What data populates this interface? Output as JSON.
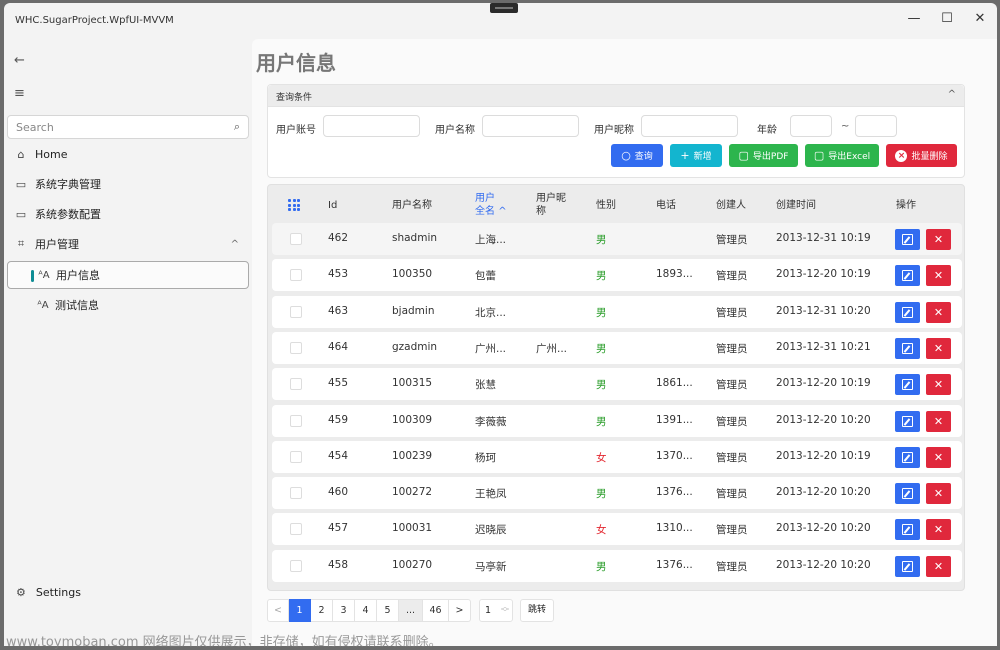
{
  "window": {
    "title": "WHC.SugarProject.WpfUI-MVVM",
    "controls": {
      "minimize": "—",
      "maximize": "☐",
      "close": "✕"
    }
  },
  "sidebar": {
    "back_icon": "←",
    "menu_icon": "≡",
    "search": {
      "placeholder": "Search",
      "value": "",
      "icon": "⌕"
    },
    "items": [
      {
        "label": "Home",
        "icon": "⌂"
      },
      {
        "label": "系统字典管理",
        "icon": "▭"
      },
      {
        "label": "系统参数配置",
        "icon": "▭"
      },
      {
        "label": "用户管理",
        "icon": "⌗",
        "expanded": true,
        "chevron": "^"
      },
      {
        "label": "用户信息",
        "icon": "ᴬA",
        "active": true
      },
      {
        "label": "测试信息",
        "icon": "ᴬA"
      }
    ],
    "settings": {
      "label": "Settings",
      "icon": "⚙"
    }
  },
  "page": {
    "title": "用户信息"
  },
  "query": {
    "header": "查询条件",
    "collapse_icon": "^",
    "fields": {
      "account": {
        "label": "用户账号",
        "value": ""
      },
      "name": {
        "label": "用户名称",
        "value": ""
      },
      "nickname": {
        "label": "用户昵称",
        "value": ""
      },
      "age": {
        "label": "年龄",
        "from": "",
        "to": "",
        "separator": "~"
      }
    },
    "buttons": {
      "search": {
        "label": "查询",
        "icon": "○"
      },
      "add": {
        "label": "新增",
        "icon": "+"
      },
      "export_pdf": {
        "label": "导出PDF",
        "icon": "▢"
      },
      "export_excel": {
        "label": "导出Excel",
        "icon": "▢"
      },
      "batch_delete": {
        "label": "批量删除",
        "icon": "×"
      }
    }
  },
  "table": {
    "columns": {
      "id": "Id",
      "username": "用户名称",
      "fullname_1": "用户",
      "fullname_2": "全名",
      "sort_icon": "^",
      "nickname_1": "用户昵",
      "nickname_2": "称",
      "gender": "性别",
      "phone": "电话",
      "creator": "创建人",
      "created": "创建时间",
      "actions": "操作"
    },
    "rows": [
      {
        "id": "462",
        "username": "shadmin",
        "fullname": "上海...",
        "nickname": "",
        "gender": "男",
        "phone": "",
        "creator": "管理员",
        "created": "2013-12-31 10:19"
      },
      {
        "id": "453",
        "username": "100350",
        "fullname": "包蕾",
        "nickname": "",
        "gender": "男",
        "phone": "1893...",
        "creator": "管理员",
        "created": "2013-12-20 10:19"
      },
      {
        "id": "463",
        "username": "bjadmin",
        "fullname": "北京...",
        "nickname": "",
        "gender": "男",
        "phone": "",
        "creator": "管理员",
        "created": "2013-12-31 10:20"
      },
      {
        "id": "464",
        "username": "gzadmin",
        "fullname": "广州...",
        "nickname": "广州...",
        "gender": "男",
        "phone": "",
        "creator": "管理员",
        "created": "2013-12-31 10:21"
      },
      {
        "id": "455",
        "username": "100315",
        "fullname": "张慧",
        "nickname": "",
        "gender": "男",
        "phone": "1861...",
        "creator": "管理员",
        "created": "2013-12-20 10:19"
      },
      {
        "id": "459",
        "username": "100309",
        "fullname": "李薇薇",
        "nickname": "",
        "gender": "男",
        "phone": "1391...",
        "creator": "管理员",
        "created": "2013-12-20 10:20"
      },
      {
        "id": "454",
        "username": "100239",
        "fullname": "杨珂",
        "nickname": "",
        "gender": "女",
        "phone": "1370...",
        "creator": "管理员",
        "created": "2013-12-20 10:19"
      },
      {
        "id": "460",
        "username": "100272",
        "fullname": "王艳凤",
        "nickname": "",
        "gender": "男",
        "phone": "1376...",
        "creator": "管理员",
        "created": "2013-12-20 10:20"
      },
      {
        "id": "457",
        "username": "100031",
        "fullname": "迟晓辰",
        "nickname": "",
        "gender": "女",
        "phone": "1310...",
        "creator": "管理员",
        "created": "2013-12-20 10:20"
      },
      {
        "id": "458",
        "username": "100270",
        "fullname": "马亭新",
        "nickname": "",
        "gender": "男",
        "phone": "1376...",
        "creator": "管理员",
        "created": "2013-12-20 10:20"
      }
    ],
    "delete_icon": "✕"
  },
  "pagination": {
    "prev": "<",
    "pages": [
      "1",
      "2",
      "3",
      "4",
      "5",
      "...",
      "46"
    ],
    "current": "1",
    "next": ">",
    "jump_value": "1",
    "jump_label": "跳转"
  },
  "colors": {
    "primary": "#326cf0",
    "info": "#13b5cf",
    "success": "#2db54d",
    "danger": "#e0283c",
    "male": "#2a9d2a",
    "female": "#e3262f",
    "accent_bar": "#0f8d95"
  },
  "watermark": "www.toymoban.com 网络图片仅供展示，非存储，如有侵权请联系删除。"
}
